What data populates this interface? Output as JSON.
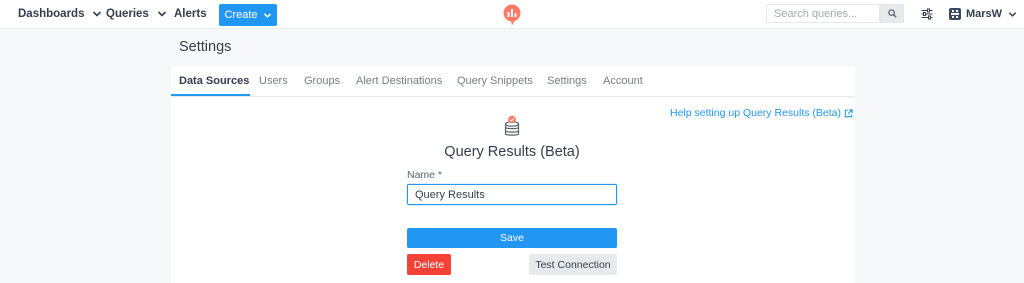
{
  "nav": {
    "dashboards_label": "Dashboards",
    "queries_label": "Queries",
    "alerts_label": "Alerts",
    "create_label": "Create",
    "search_placeholder": "Search queries...",
    "user_name": "MarsW",
    "icons": {
      "dashboards_dropdown": "chevron-down-icon",
      "queries_dropdown": "chevron-down-icon",
      "create_dropdown": "chevron-down-icon",
      "logo": "redash-logo-icon",
      "search": "search-icon",
      "settings": "sliders-icon",
      "user_avatar": "avatar-icon",
      "user_dropdown": "chevron-down-icon"
    }
  },
  "page": {
    "title": "Settings"
  },
  "tabs": [
    {
      "label": "Data Sources",
      "active": true
    },
    {
      "label": "Users",
      "active": false
    },
    {
      "label": "Groups",
      "active": false
    },
    {
      "label": "Alert Destinations",
      "active": false
    },
    {
      "label": "Query Snippets",
      "active": false
    },
    {
      "label": "Settings",
      "active": false
    },
    {
      "label": "Account",
      "active": false
    }
  ],
  "form": {
    "help_link": "Help setting up Query Results (Beta)",
    "help_icon": "external-link-icon",
    "data_source_icon": "database-icon",
    "data_source_type": "Query Results (Beta)",
    "name_label": "Name *",
    "name_value": "Query Results",
    "save_label": "Save",
    "delete_label": "Delete",
    "test_label": "Test Connection"
  },
  "colors": {
    "accent": "#2196f3",
    "danger": "#f44336",
    "logo": "#ff7964",
    "background": "#f6f8f9"
  }
}
